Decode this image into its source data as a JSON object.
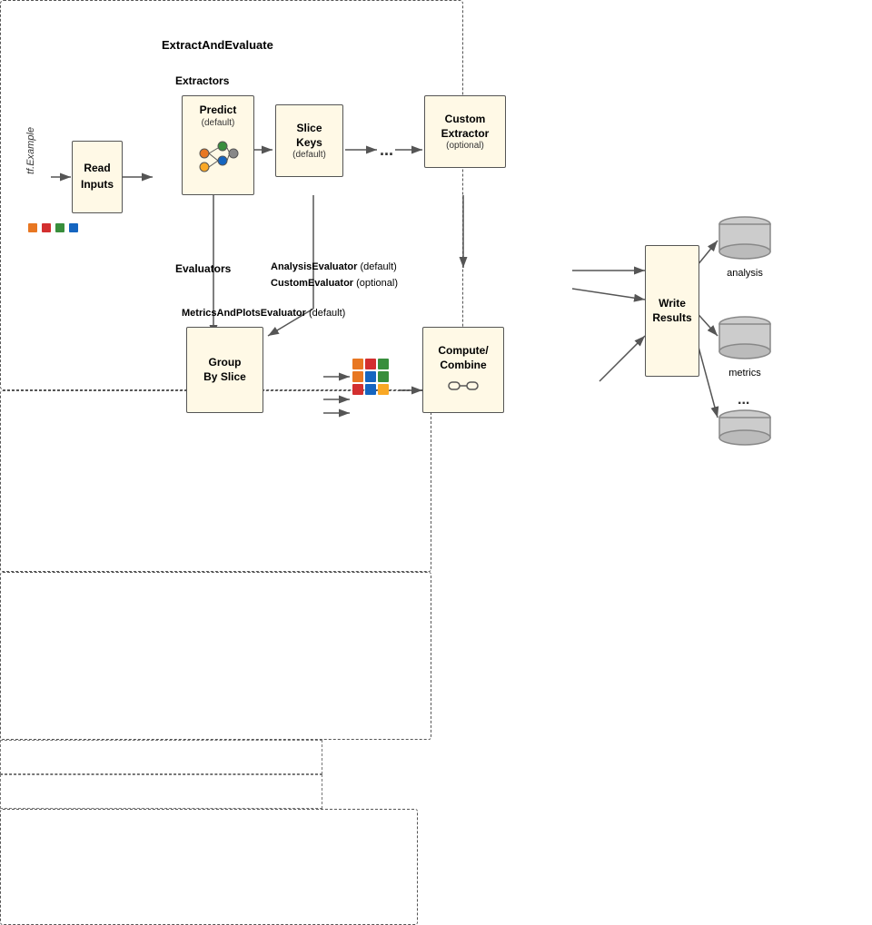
{
  "diagram": {
    "title": "ExtractAndEvaluate",
    "read_inputs": {
      "label": "Read\nInputs",
      "label_lines": [
        "Read",
        "Inputs"
      ]
    },
    "tf_example": "tf.Example",
    "extractors": {
      "label": "Extractors",
      "predict": {
        "label": "Predict",
        "sublabel": "(default)"
      },
      "slice_keys": {
        "label": "Slice\nKeys",
        "sublabel": "(default)",
        "label_lines": [
          "Slice",
          "Keys"
        ]
      },
      "custom_extractor": {
        "label": "Custom\nExtractor",
        "sublabel": "(optional)",
        "label_lines": [
          "Custom",
          "Extractor"
        ]
      },
      "ellipsis": "..."
    },
    "evaluators": {
      "label": "Evaluators",
      "analysis_evaluator": {
        "label": "AnalysisEvaluator",
        "sublabel": "(default)"
      },
      "custom_evaluator": {
        "label": "CustomEvaluator",
        "sublabel": "(optional)"
      },
      "metrics_plots": {
        "label": "MetricsAndPlotsEvaluator",
        "sublabel": "(default)",
        "group_by_slice": {
          "label": "Group\nBy Slice",
          "label_lines": [
            "Group",
            "By Slice"
          ]
        },
        "compute_combine": {
          "label": "Compute/\nCombine",
          "label_lines": [
            "Compute/",
            "Combine"
          ]
        }
      }
    },
    "write_results": {
      "label_lines": [
        "Write",
        "Results"
      ]
    },
    "outputs": {
      "analysis": "analysis",
      "metrics": "metrics",
      "ellipsis": "..."
    },
    "colors": {
      "orange": "#E87722",
      "red": "#D32F2F",
      "green": "#388E3C",
      "blue": "#1565C0",
      "yellow": "#F9A825",
      "box_bg": "#FFF9E0",
      "box_border": "#555555"
    }
  }
}
